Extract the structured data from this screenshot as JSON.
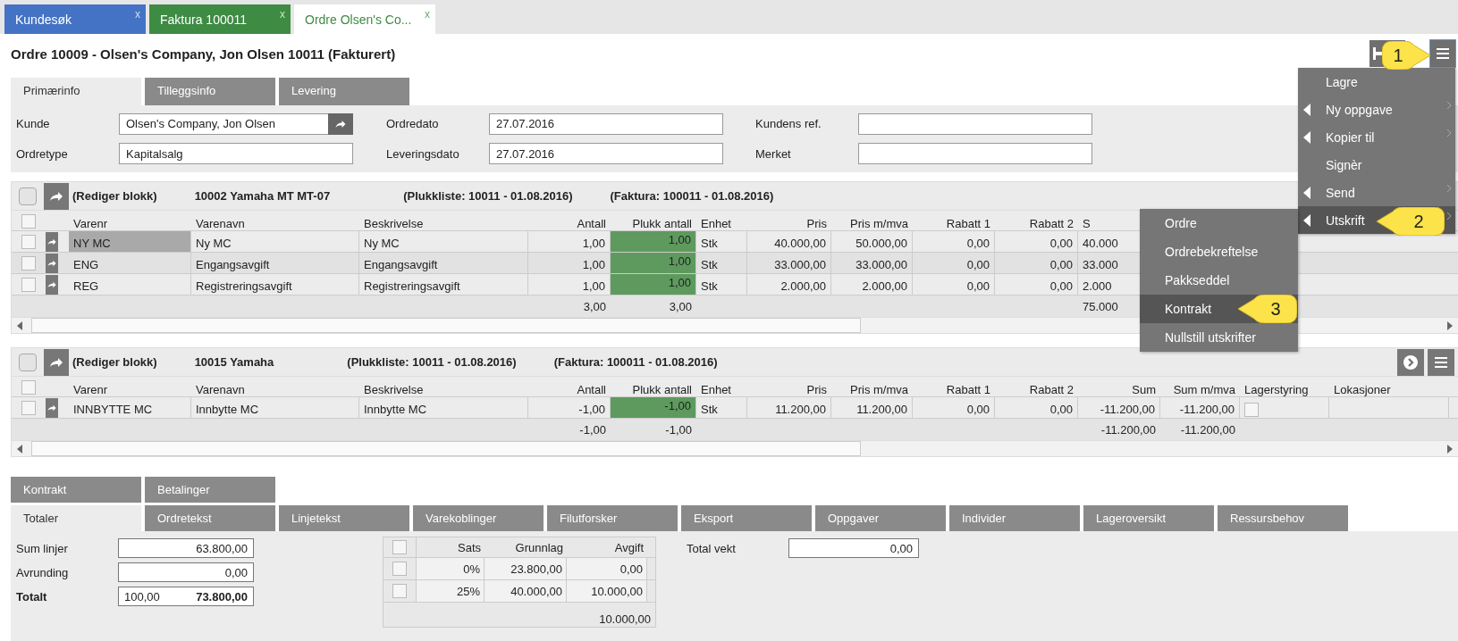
{
  "open_tabs": [
    {
      "label": "Kundesøk",
      "close": "x",
      "color": "#4472c4",
      "selected": false
    },
    {
      "label": "Faktura 100011",
      "close": "x",
      "color": "#3e8b43",
      "selected": false
    },
    {
      "label": "Ordre Olsen's Co...",
      "close": "x",
      "color": "#3e8b43",
      "selected": true
    }
  ],
  "title": "Ordre 10009 - Olsen's Company, Jon Olsen 10011 (Fakturert)",
  "form_tabs": [
    {
      "label": "Primærinfo",
      "selected": true
    },
    {
      "label": "Tilleggsinfo",
      "selected": false
    },
    {
      "label": "Levering",
      "selected": false
    }
  ],
  "fields": [
    {
      "label": "Kunde",
      "value": "Olsen's Company, Jon Olsen",
      "kind": "link"
    },
    {
      "label": "Ordredato",
      "value": "27.07.2016",
      "kind": "text"
    },
    {
      "label": "Kundens ref.",
      "kind": "text"
    },
    {
      "label": "Ordretype",
      "value": "Kapitalsalg",
      "kind": "text"
    },
    {
      "label": "Leveringsdato",
      "value": "27.07.2016",
      "kind": "text"
    },
    {
      "label": "Merket",
      "kind": "text"
    }
  ],
  "blocks": [
    {
      "checked": false,
      "edit_label": "(Rediger blokk)",
      "title": "10002 Yamaha MT MT-07",
      "picklist": "(Plukkliste: 10011 - 01.08.2016)",
      "invoice": "(Faktura: 100011 - 01.08.2016)",
      "header_checked": false,
      "buttons": false,
      "columns": [
        {
          "label": "Varenr",
          "kind": "text"
        },
        {
          "label": "Varenavn",
          "kind": "text"
        },
        {
          "label": "Beskrivelse",
          "kind": "text"
        },
        {
          "label": "Antall",
          "kind": "number",
          "total": "3,00"
        },
        {
          "label": "Plukk antall",
          "kind": "pick",
          "total": "3,00"
        },
        {
          "label": "Enhet",
          "kind": "text"
        },
        {
          "label": "Pris",
          "kind": "number"
        },
        {
          "label": "Pris m/mva",
          "kind": "number"
        },
        {
          "label": "Rabatt 1",
          "kind": "number"
        },
        {
          "label": "Rabatt 2",
          "kind": "number"
        },
        {
          "label": "S",
          "kind": "text",
          "total": "75.000"
        }
      ],
      "rows": [
        {
          "checked": false,
          "selected": true,
          "cells": [
            "NY MC",
            "Ny MC",
            "Ny MC",
            "1,00",
            "1,00",
            "Stk",
            "40.000,00",
            "50.000,00",
            "0,00",
            "0,00",
            "40.000"
          ]
        },
        {
          "checked": false,
          "selected": false,
          "cells": [
            "ENG",
            "Engangsavgift",
            "Engangsavgift",
            "1,00",
            "1,00",
            "Stk",
            "33.000,00",
            "33.000,00",
            "0,00",
            "0,00",
            "33.000"
          ]
        },
        {
          "checked": false,
          "selected": false,
          "cells": [
            "REG",
            "Registreringsavgift",
            "Registreringsavgift",
            "1,00",
            "1,00",
            "Stk",
            "2.000,00",
            "2.000,00",
            "0,00",
            "0,00",
            "2.000"
          ]
        }
      ]
    },
    {
      "checked": false,
      "edit_label": "(Rediger blokk)",
      "title": "10015 Yamaha",
      "picklist": "(Plukkliste: 10011 - 01.08.2016)",
      "invoice": "(Faktura: 100011 - 01.08.2016)",
      "header_checked": false,
      "buttons": true,
      "columns": [
        {
          "label": "Varenr",
          "kind": "text"
        },
        {
          "label": "Varenavn",
          "kind": "text"
        },
        {
          "label": "Beskrivelse",
          "kind": "text"
        },
        {
          "label": "Antall",
          "kind": "number",
          "total": "-1,00"
        },
        {
          "label": "Plukk antall",
          "kind": "pick",
          "total": "-1,00"
        },
        {
          "label": "Enhet",
          "kind": "text"
        },
        {
          "label": "Pris",
          "kind": "number"
        },
        {
          "label": "Pris m/mva",
          "kind": "number"
        },
        {
          "label": "Rabatt 1",
          "kind": "number"
        },
        {
          "label": "Rabatt 2",
          "kind": "number"
        },
        {
          "label": "Sum",
          "kind": "number",
          "total": "-11.200,00"
        },
        {
          "label": "Sum m/mva",
          "kind": "number",
          "total": "-11.200,00"
        },
        {
          "label": "Lagerstyring",
          "kind": "check"
        },
        {
          "label": "Lokasjoner",
          "kind": "blank"
        }
      ],
      "rows": [
        {
          "checked": false,
          "selected": false,
          "stock_checked": false,
          "cells": [
            "INNBYTTE MC",
            "Innbytte MC",
            "Innbytte MC",
            "-1,00",
            "-1,00",
            "Stk",
            "11.200,00",
            "11.200,00",
            "0,00",
            "0,00",
            "-11.200,00",
            "-11.200,00"
          ]
        }
      ]
    }
  ],
  "bottom_tabs": [
    [
      {
        "label": "Kontrakt",
        "selected": false
      },
      {
        "label": "Betalinger",
        "selected": false
      }
    ],
    [
      {
        "label": "Totaler",
        "selected": true
      },
      {
        "label": "Ordretekst",
        "selected": false
      },
      {
        "label": "Linjetekst",
        "selected": false
      },
      {
        "label": "Varekoblinger",
        "selected": false
      },
      {
        "label": "Filutforsker",
        "selected": false
      },
      {
        "label": "Eksport",
        "selected": false
      },
      {
        "label": "Oppgaver",
        "selected": false
      },
      {
        "label": "Individer",
        "selected": false
      },
      {
        "label": "Lageroversikt",
        "selected": false
      },
      {
        "label": "Ressursbehov",
        "selected": false
      }
    ]
  ],
  "totals": [
    {
      "label": "Sum linjer",
      "value": "63.800,00",
      "kind": "plain"
    },
    {
      "label": "Avrunding",
      "value": "0,00",
      "kind": "plain"
    },
    {
      "label": "Totalt",
      "prefix": "100,00",
      "value": "73.800,00",
      "kind": "total"
    }
  ],
  "vat_table": {
    "header_checked": false,
    "columns": [
      "Sats",
      "Grunnlag",
      "Avgift"
    ],
    "rows": [
      {
        "checked": false,
        "cells": [
          "0%",
          "23.800,00",
          "0,00"
        ]
      },
      {
        "checked": false,
        "cells": [
          "25%",
          "40.000,00",
          "10.000,00"
        ]
      }
    ],
    "total": "10.000,00"
  },
  "weight": {
    "label": "Total vekt",
    "value": "0,00"
  },
  "menu": {
    "items": [
      {
        "label": "Lagre",
        "has_submenu": false,
        "selected": false
      },
      {
        "label": "Ny oppgave",
        "has_submenu": true,
        "selected": false
      },
      {
        "label": "Kopier til",
        "has_submenu": true,
        "selected": false
      },
      {
        "label": "Signèr",
        "has_submenu": false,
        "selected": false
      },
      {
        "label": "Send",
        "has_submenu": true,
        "selected": false
      },
      {
        "label": "Utskrift",
        "has_submenu": true,
        "selected": true
      }
    ],
    "submenu": [
      {
        "label": "Ordre",
        "selected": false
      },
      {
        "label": "Ordrebekreftelse",
        "selected": false
      },
      {
        "label": "Pakkseddel",
        "selected": false
      },
      {
        "label": "Kontrakt",
        "selected": true
      },
      {
        "label": "Nullstill utskrifter",
        "selected": false
      }
    ]
  },
  "callouts": [
    {
      "label": "1"
    },
    {
      "label": "2"
    },
    {
      "label": "3"
    }
  ]
}
